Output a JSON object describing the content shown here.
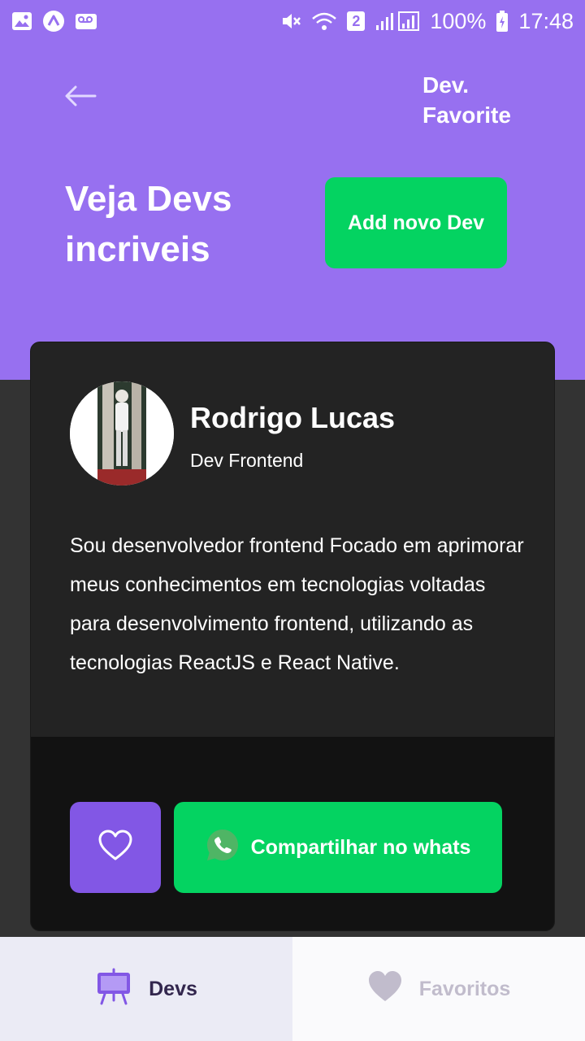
{
  "status_bar": {
    "battery": "100%",
    "time": "17:48",
    "sim_slot": "2",
    "left_icons": [
      "gallery-icon",
      "app-icon",
      "voicemail-icon"
    ],
    "right_icons": [
      "mute-icon",
      "wifi-icon",
      "signal-icon",
      "battery-charging-icon"
    ]
  },
  "header": {
    "brand": "Dev. Favorite",
    "title": "Veja Devs incriveis",
    "add_button_label": "Add novo Dev",
    "back_icon": "arrow-left-icon"
  },
  "profile": {
    "name": "Rodrigo Lucas",
    "role": "Dev Frontend",
    "bio": "Sou desenvolvedor frontend Focado em aprimorar meus conhecimentos em tecnologias voltadas para desenvolvimento frontend, utilizando as tecnologias ReactJS e React Native.",
    "favorite_icon": "heart-outline-icon",
    "share_label": "Compartilhar no whats",
    "share_icon": "whatsapp-icon"
  },
  "tabs": [
    {
      "label": "Devs",
      "icon": "easel-icon",
      "active": true
    },
    {
      "label": "Favoritos",
      "icon": "heart-icon",
      "active": false
    }
  ],
  "colors": {
    "header_bg": "#9770f0",
    "accent_green": "#04d361",
    "accent_purple": "#8257e5",
    "card_bg": "#232323",
    "card_footer_bg": "#121212",
    "page_bg": "#333333"
  }
}
